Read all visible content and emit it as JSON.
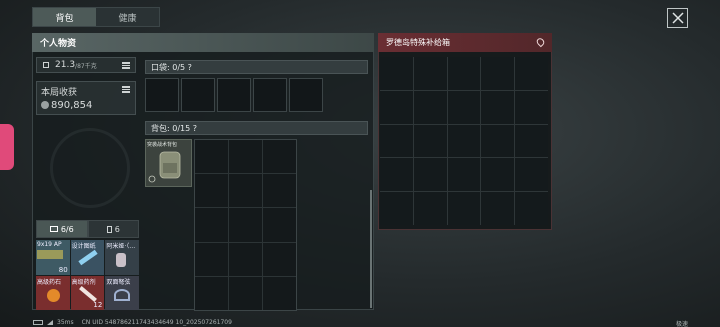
{
  "tabs": [
    {
      "label": "背包"
    },
    {
      "label": "健康"
    }
  ],
  "personal": {
    "header": "个人物资",
    "weight_value": "21.3",
    "weight_max": "/87千克",
    "earnings_label": "本局收获",
    "earnings_value": "890,854"
  },
  "pocket": {
    "label": "口袋: 0/5  ?"
  },
  "backpack": {
    "label": "背包: 0/15  ?",
    "item_name": "突袭战术背包"
  },
  "quick": {
    "tab1": "6/6",
    "tab2": "6",
    "items": [
      {
        "name": "9x19 AP",
        "count": "80"
      },
      {
        "name": "设计图纸",
        "count": ""
      },
      {
        "name": "阿米娅·（…",
        "count": ""
      },
      {
        "name": "高级药石",
        "count": ""
      },
      {
        "name": "高级药剂",
        "count": "12"
      },
      {
        "name": "双面弩弦",
        "count": ""
      }
    ]
  },
  "supply": {
    "header": "罗德岛特殊补给箱"
  },
  "footer": {
    "ping": "35ms",
    "uid": "CN UID 548786211743434649 10_202507261709",
    "right": "极速"
  },
  "colors": {
    "left_header": "#596665",
    "right_header": "#6a2e33",
    "side_badge": "#e04a7a"
  }
}
